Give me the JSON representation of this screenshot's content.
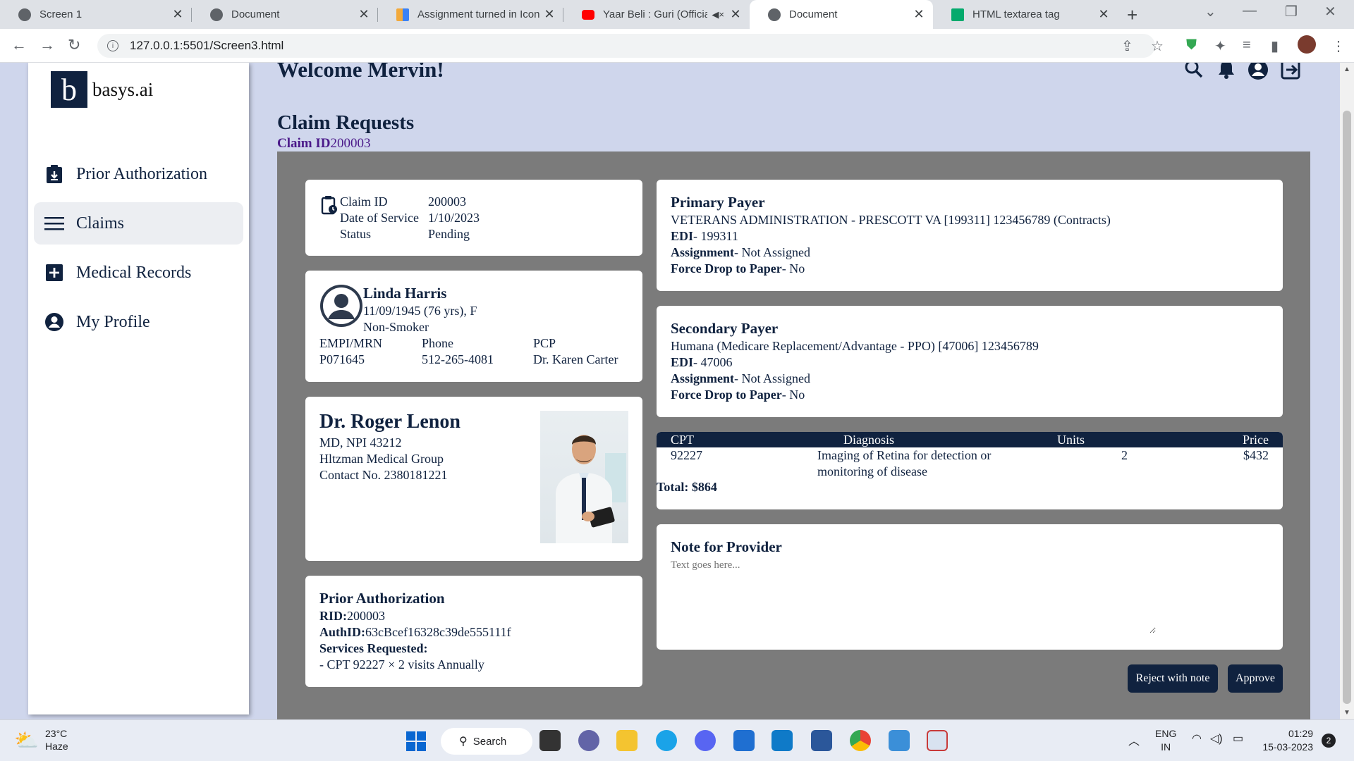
{
  "browser": {
    "tabs": [
      {
        "title": "Screen 1",
        "favicon_color": "#5f6368"
      },
      {
        "title": "Document",
        "favicon_color": "#5f6368"
      },
      {
        "title": "Assignment turned in Icon |",
        "favicon_color": "#f2a93b"
      },
      {
        "title": "Yaar Beli : Guri (Official",
        "favicon_color": "#ff0000"
      },
      {
        "title": "Document",
        "favicon_color": "#5f6368"
      },
      {
        "title": "HTML textarea tag",
        "favicon_color": "#04aa6d"
      }
    ],
    "active_tab": 4,
    "url": "127.0.0.1:5501/Screen3.html"
  },
  "sidebar": {
    "logo_letter": "b",
    "brand": "basys.ai",
    "items": [
      {
        "label": "Prior Authorization",
        "icon": "clipboard-download-icon"
      },
      {
        "label": "Claims",
        "icon": "menu-lines-icon"
      },
      {
        "label": "Medical Records",
        "icon": "plus-square-icon"
      },
      {
        "label": "My Profile",
        "icon": "user-circle-icon"
      }
    ],
    "selected": 1
  },
  "header": {
    "welcome": "Welcome Mervin!",
    "section_title": "Claim Requests",
    "claim_id_label": "Claim ID",
    "claim_id_value": "200003"
  },
  "claim_summary": {
    "id_label": "Claim ID",
    "id_value": "200003",
    "dos_label": "Date of Service",
    "dos_value": "1/10/2023",
    "status_label": "Status",
    "status_value": "Pending"
  },
  "patient": {
    "name": "Linda Harris",
    "dob": "11/09/1945 (76 yrs), F",
    "smoker": "Non-Smoker",
    "empi_label": "EMPI/MRN",
    "empi_value": "P071645",
    "phone_label": "Phone",
    "phone_value": "512-265-4081",
    "pcp_label": "PCP",
    "pcp_value": "Dr. Karen Carter"
  },
  "provider": {
    "name": "Dr. Roger Lenon",
    "credentials": "MD, NPI 43212",
    "group": "Hltzman Medical Group",
    "contact": "Contact No. 2380181221"
  },
  "prior_auth": {
    "title": "Prior Authorization",
    "rid_label": "RID:",
    "rid_value": "200003",
    "auth_label": "AuthID:",
    "auth_value": "63cBcef16328c39de555111f",
    "services_label": "Services Requested:",
    "services_value": "- CPT 92227 × 2 visits Annually"
  },
  "primary_payer": {
    "title": "Primary Payer",
    "name": "VETERANS ADMINISTRATION - PRESCOTT VA [199311] 123456789 (Contracts)",
    "edi_label": "EDI",
    "edi_value": "- 199311",
    "assign_label": "Assignment",
    "assign_value": "- Not Assigned",
    "force_label": "Force Drop to Paper",
    "force_value": "- No"
  },
  "secondary_payer": {
    "title": "Secondary Payer",
    "name": "Humana (Medicare Replacement/Advantage - PPO) [47006] 123456789",
    "edi_label": "EDI",
    "edi_value": "- 47006",
    "assign_label": "Assignment",
    "assign_value": "- Not Assigned",
    "force_label": "Force Drop to Paper",
    "force_value": "- No"
  },
  "cpt_table": {
    "headers": [
      "CPT",
      "Diagnosis",
      "Units",
      "Price"
    ],
    "rows": [
      {
        "cpt": "92227",
        "diagnosis_line1": "Imaging of Retina for detection or",
        "diagnosis_line2": "monitoring of disease",
        "units": "2",
        "price": "$432"
      }
    ],
    "total": "Total: $864"
  },
  "note": {
    "title": "Note for Provider",
    "placeholder": "Text goes here..."
  },
  "actions": {
    "reject": "Reject with note",
    "approve": "Approve"
  },
  "taskbar": {
    "weather_temp": "23°C",
    "weather_desc": "Haze",
    "search": "Search",
    "lang1": "ENG",
    "lang2": "IN",
    "time": "01:29",
    "date": "15-03-2023",
    "notif_count": "2"
  }
}
